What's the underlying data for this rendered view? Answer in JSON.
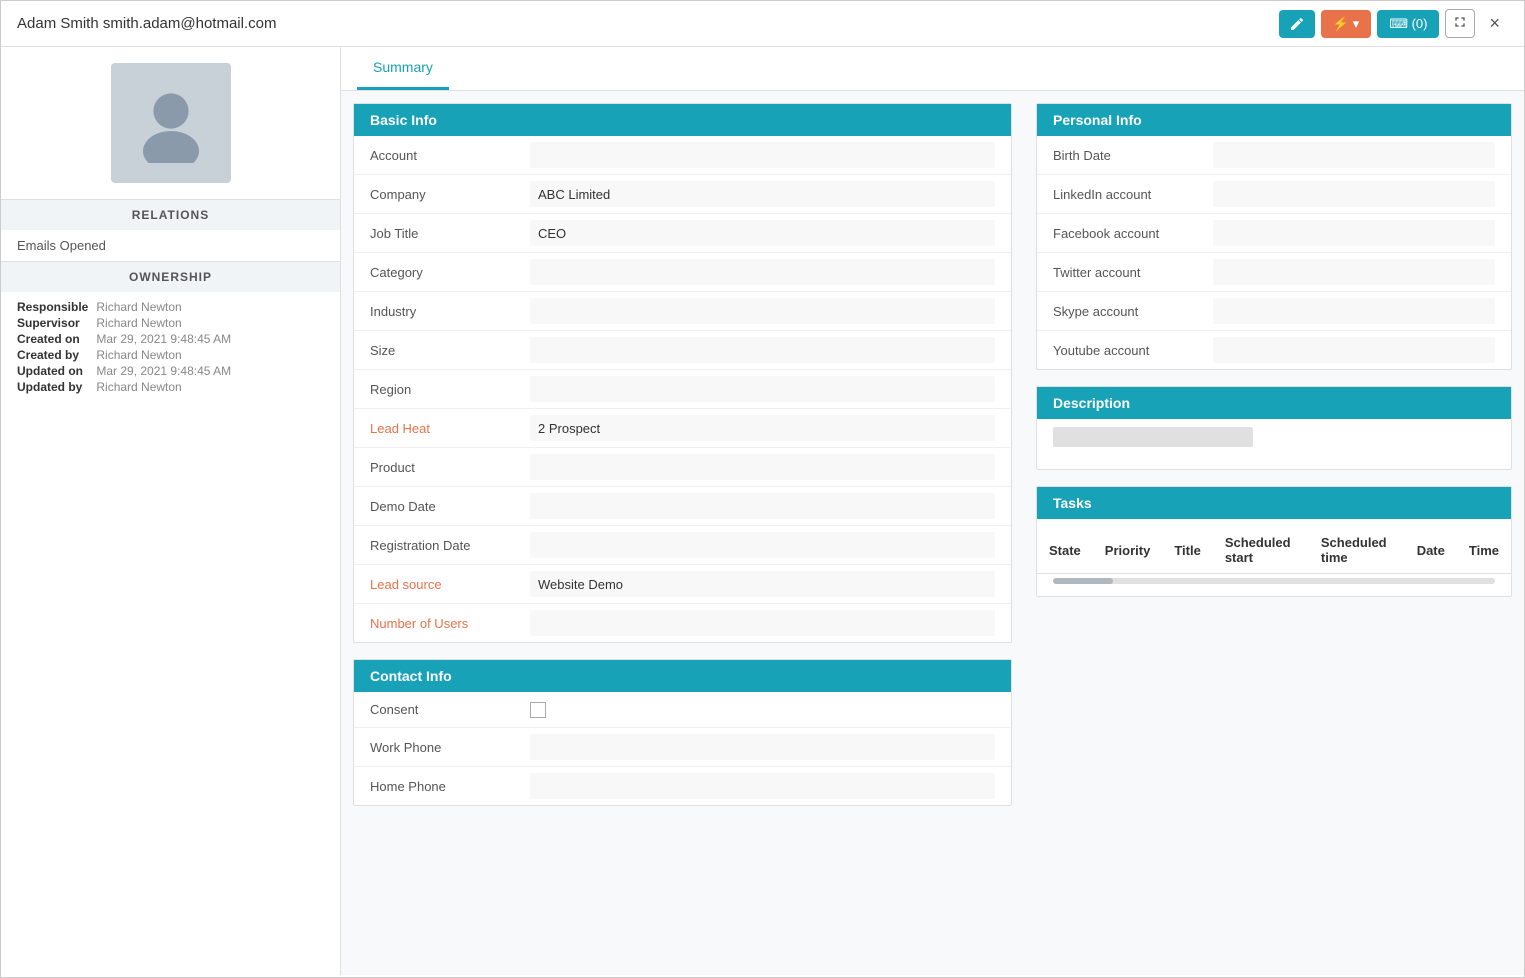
{
  "header": {
    "title": "Adam Smith smith.adam@hotmail.com",
    "btn_edit_label": "Edit",
    "btn_dropdown_label": "▾",
    "btn_chat_label": "⌨ (0)",
    "btn_expand_label": "⛶",
    "btn_close_label": "×"
  },
  "tabs": [
    {
      "label": "Summary",
      "active": true
    }
  ],
  "sidebar": {
    "relations_title": "RELATIONS",
    "relations_items": [
      "Emails Opened"
    ],
    "ownership_title": "OWNERSHIP",
    "ownership_fields": [
      {
        "label": "Responsible",
        "value": "Richard Newton"
      },
      {
        "label": "Supervisor",
        "value": "Richard Newton"
      },
      {
        "label": "Created on",
        "value": "Mar 29, 2021 9:48:45 AM"
      },
      {
        "label": "Created by",
        "value": "Richard Newton"
      },
      {
        "label": "Updated on",
        "value": "Mar 29, 2021 9:48:45 AM"
      },
      {
        "label": "Updated by",
        "value": "Richard Newton"
      }
    ]
  },
  "basic_info": {
    "title": "Basic Info",
    "fields": [
      {
        "label": "Account",
        "value": "",
        "orange": false
      },
      {
        "label": "Company",
        "value": "ABC Limited",
        "orange": false
      },
      {
        "label": "Job Title",
        "value": "CEO",
        "orange": false
      },
      {
        "label": "Category",
        "value": "",
        "orange": false
      },
      {
        "label": "Industry",
        "value": "",
        "orange": false
      },
      {
        "label": "Size",
        "value": "",
        "orange": false
      },
      {
        "label": "Region",
        "value": "",
        "orange": false
      },
      {
        "label": "Lead Heat",
        "value": "2 Prospect",
        "orange": true
      },
      {
        "label": "Product",
        "value": "",
        "orange": false
      },
      {
        "label": "Demo Date",
        "value": "",
        "orange": false
      },
      {
        "label": "Registration Date",
        "value": "",
        "orange": false
      },
      {
        "label": "Lead source",
        "value": "Website Demo",
        "orange": true
      },
      {
        "label": "Number of Users",
        "value": "",
        "orange": true
      }
    ]
  },
  "contact_info": {
    "title": "Contact Info",
    "fields": [
      {
        "label": "Consent",
        "value": "",
        "type": "checkbox",
        "orange": false
      },
      {
        "label": "Work Phone",
        "value": "",
        "orange": false
      },
      {
        "label": "Home Phone",
        "value": "",
        "orange": false
      }
    ]
  },
  "personal_info": {
    "title": "Personal Info",
    "fields": [
      {
        "label": "Birth Date",
        "value": ""
      },
      {
        "label": "LinkedIn account",
        "value": ""
      },
      {
        "label": "Facebook account",
        "value": ""
      },
      {
        "label": "Twitter account",
        "value": ""
      },
      {
        "label": "Skype account",
        "value": ""
      },
      {
        "label": "Youtube account",
        "value": ""
      }
    ]
  },
  "description": {
    "title": "Description"
  },
  "tasks": {
    "title": "Tasks",
    "columns": [
      "State",
      "Priority",
      "Title",
      "Scheduled start",
      "Scheduled time",
      "Date",
      "Time"
    ]
  }
}
